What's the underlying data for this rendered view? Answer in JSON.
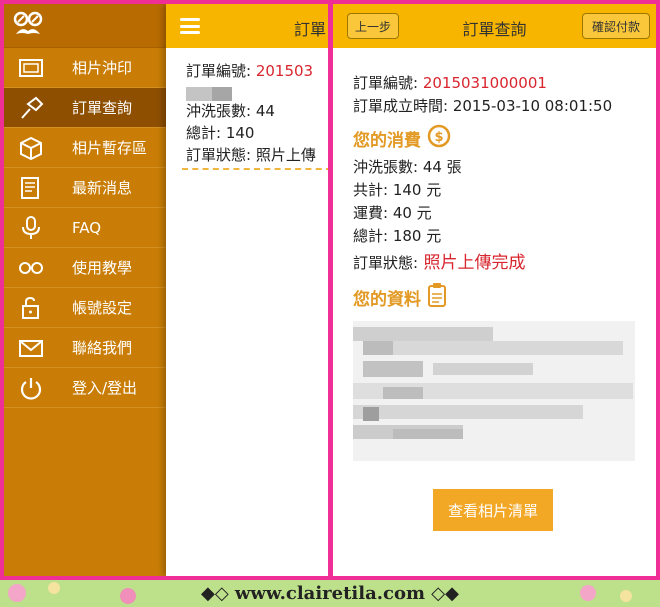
{
  "drawer": {
    "items": [
      {
        "icon": "photo-print-icon",
        "label": "相片沖印"
      },
      {
        "icon": "pin-icon",
        "label": "訂單查詢"
      },
      {
        "icon": "box-icon",
        "label": "相片暫存區"
      },
      {
        "icon": "news-icon",
        "label": "最新消息"
      },
      {
        "icon": "microphone-icon",
        "label": "FAQ"
      },
      {
        "icon": "glasses-icon",
        "label": "使用教學"
      },
      {
        "icon": "unlock-icon",
        "label": "帳號設定"
      },
      {
        "icon": "mail-icon",
        "label": "聯絡我們"
      },
      {
        "icon": "power-icon",
        "label": "登入/登出"
      }
    ],
    "active_index": 1
  },
  "behind_screen": {
    "title": "訂單",
    "order_no_label": "訂單編號:",
    "order_no_value": "201503",
    "count_line": "沖洗張數: 44",
    "total_line": "總計: 140",
    "status_label": "訂單狀態:",
    "status_value": "照片上傳"
  },
  "order_screen": {
    "header": {
      "prev_button": "上一步",
      "title": "訂單查詢",
      "confirm_button": "確認付款"
    },
    "order_no_label": "訂單編號:",
    "order_no_value": "2015031000001",
    "created_line": "訂單成立時間: 2015-03-10 08:01:50",
    "consumption_title": "您的消費",
    "count_line": "沖洗張數: 44 張",
    "subtotal_line": "共計: 140 元",
    "shipping_line": "運費: 40 元",
    "total_line": "總計: 180 元",
    "status_label": "訂單狀態:",
    "status_value": "照片上傳完成",
    "info_title": "您的資料",
    "photo_list_button": "查看相片清單"
  },
  "footer": {
    "watermark": "◆◇ www.clairetila.com ◇◆"
  },
  "colors": {
    "accent_yellow": "#f7b500",
    "drawer_orange": "#c97d06",
    "status_red": "#d8252e",
    "frame_pink": "#ef2f95"
  }
}
